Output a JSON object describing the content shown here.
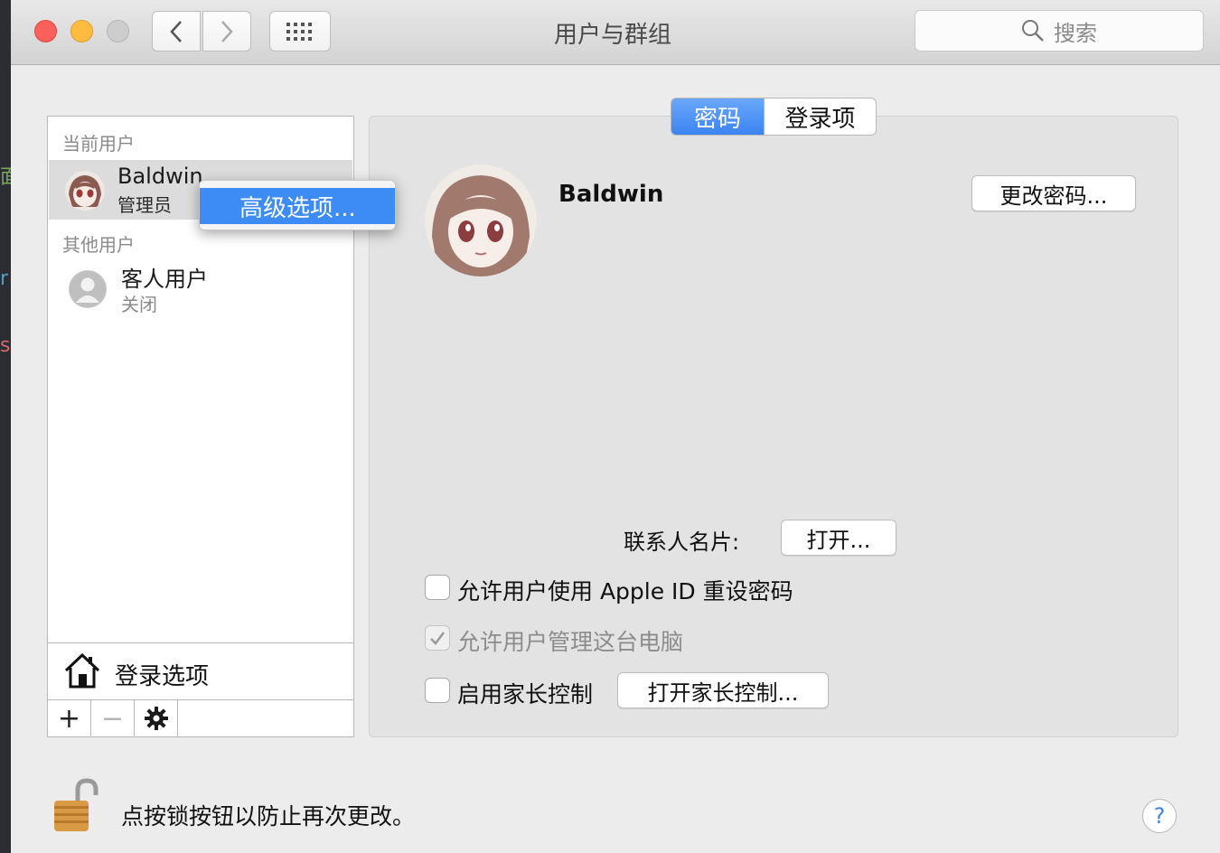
{
  "window": {
    "title": "用户与群组"
  },
  "toolbar": {
    "search_placeholder": "搜索"
  },
  "sidebar": {
    "current_section": "当前用户",
    "current_user": {
      "name": "Baldwin",
      "role": "管理员"
    },
    "other_section": "其他用户",
    "other_users": [
      {
        "name": "客人用户",
        "status": "关闭"
      }
    ],
    "login_options_label": "登录选项",
    "buttons": {
      "add": "+",
      "remove": "−"
    }
  },
  "context_menu": {
    "item": "高级选项..."
  },
  "panel": {
    "tabs": [
      {
        "label": "密码",
        "active": true
      },
      {
        "label": "登录项",
        "active": false
      }
    ],
    "user_name": "Baldwin",
    "change_password_button": "更改密码...",
    "contact_card_label": "联系人名片:",
    "open_button": "打开...",
    "checkboxes": [
      {
        "label": "允许用户使用 Apple ID 重设密码",
        "checked": false,
        "enabled": true
      },
      {
        "label": "允许用户管理这台电脑",
        "checked": true,
        "enabled": false
      },
      {
        "label": "启用家长控制",
        "checked": false,
        "enabled": true
      }
    ],
    "parental_controls_button": "打开家长控制..."
  },
  "footer": {
    "lock_text": "点按锁按钮以防止再次更改。",
    "help": "?"
  },
  "colors": {
    "accent": "#3c84f1",
    "selected_row": "#dcdcdc"
  }
}
